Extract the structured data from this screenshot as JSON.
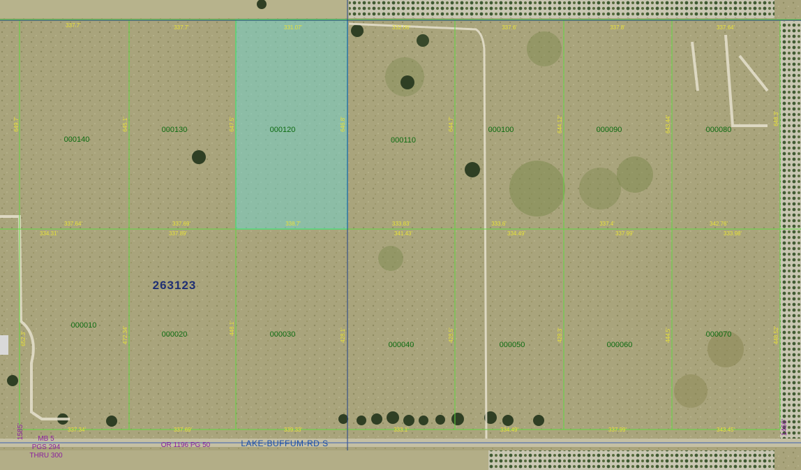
{
  "section": {
    "id": "263123"
  },
  "parcels": [
    {
      "id": "000140",
      "selected": false
    },
    {
      "id": "000130",
      "selected": false
    },
    {
      "id": "000120",
      "selected": true
    },
    {
      "id": "000110",
      "selected": false
    },
    {
      "id": "000100",
      "selected": false
    },
    {
      "id": "000090",
      "selected": false
    },
    {
      "id": "000080",
      "selected": false
    },
    {
      "id": "000010",
      "selected": false
    },
    {
      "id": "000020",
      "selected": false
    },
    {
      "id": "000030",
      "selected": false
    },
    {
      "id": "000040",
      "selected": false
    },
    {
      "id": "000050",
      "selected": false
    },
    {
      "id": "000060",
      "selected": false
    },
    {
      "id": "000070",
      "selected": false
    }
  ],
  "road": {
    "name": "LAKE-BUFFUM-RD S",
    "book_ref": "OR 1196 PG 50"
  },
  "plat_book": {
    "line1": "MB 5",
    "line2": "PGS 294",
    "line3": "THRU 300"
  },
  "edge_labels": {
    "left": "1585'",
    "right": "1466'"
  },
  "dimensions": {
    "top": [
      "337.7'",
      "337.7'",
      "331.07'",
      "332.06'",
      "337.6'",
      "337.8'",
      "337.64'"
    ],
    "mid_upper": [
      "337.64'",
      "337.69'",
      "338.7'",
      "333.83'",
      "333.6'",
      "337.4'",
      "342.76'"
    ],
    "mid_lower": [
      "334.31'",
      "337.89'",
      "341.43'",
      "334.49'",
      "337.99'",
      "333.98'"
    ],
    "bottom": [
      "337.34'",
      "337.69'",
      "339.33'",
      "333.1'",
      "334.49'",
      "337.99'",
      "343.45'"
    ],
    "vert_upper": [
      "649.7'",
      "645.1'",
      "647.5'",
      "646.8'",
      "644.7'",
      "644.12'",
      "643.44'",
      "648.3'"
    ],
    "vert_lower": [
      "652.3'",
      "472.34'",
      "448.1'",
      "428.1'",
      "428.5'",
      "428.3'",
      "444.5'",
      "448.52'"
    ]
  },
  "colors": {
    "parcel_line": "#5fd93f",
    "selected_fill": "#6fd6cf",
    "selected_stroke": "#3fd9e0",
    "parcel_label": "#0c6b10",
    "dimension": "#e8e23a",
    "road_label": "#1a4fa8",
    "section_label": "#1f2f73",
    "record_label": "#8a1f9e"
  }
}
